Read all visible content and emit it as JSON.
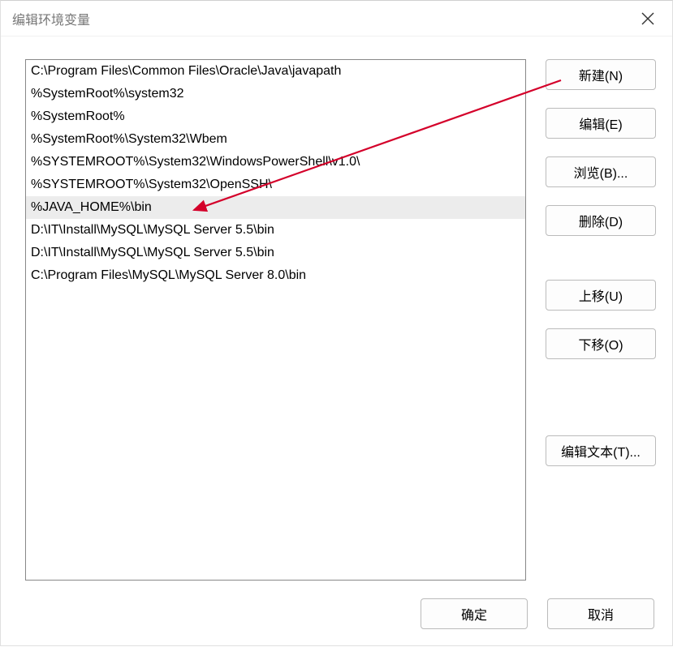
{
  "window": {
    "title": "编辑环境变量"
  },
  "list": {
    "items": [
      "C:\\Program Files\\Common Files\\Oracle\\Java\\javapath",
      "%SystemRoot%\\system32",
      "%SystemRoot%",
      "%SystemRoot%\\System32\\Wbem",
      "%SYSTEMROOT%\\System32\\WindowsPowerShell\\v1.0\\",
      "%SYSTEMROOT%\\System32\\OpenSSH\\",
      "%JAVA_HOME%\\bin",
      "D:\\IT\\Install\\MySQL\\MySQL Server 5.5\\bin",
      "D:\\IT\\Install\\MySQL\\MySQL Server 5.5\\bin",
      "C:\\Program Files\\MySQL\\MySQL Server 8.0\\bin"
    ],
    "selected_index": 6
  },
  "buttons": {
    "new": "新建(N)",
    "edit": "编辑(E)",
    "browse": "浏览(B)...",
    "delete": "删除(D)",
    "move_up": "上移(U)",
    "move_down": "下移(O)",
    "edit_text": "编辑文本(T)...",
    "ok": "确定",
    "cancel": "取消"
  }
}
